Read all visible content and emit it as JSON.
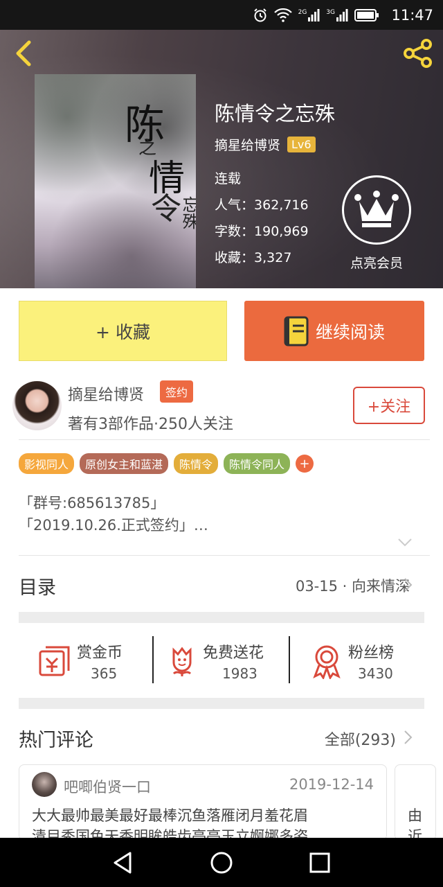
{
  "status_bar": {
    "time": "11:47",
    "network_1": "2G",
    "network_2": "3G"
  },
  "book": {
    "title": "陈情令之忘殊",
    "author": "摘星给博贤",
    "author_level": "Lv6",
    "status": "连载",
    "popularity_label": "人气：",
    "popularity": "362,716",
    "words_label": "字数：",
    "words": "190,969",
    "favorites_label": "收藏：",
    "favorites": "3,327"
  },
  "cover": {
    "title_char_1": "陈",
    "title_char_2": "之",
    "title_char_3": "情",
    "title_char_4": "令",
    "subtitle": "忘殊"
  },
  "vip": {
    "label": "点亮会员"
  },
  "actions": {
    "collect": "+ 收藏",
    "read": "继续阅读"
  },
  "author_card": {
    "name": "摘星给博贤",
    "badge": "签约",
    "stats": "著有3部作品·250人关注",
    "follow": "+关注"
  },
  "tags": [
    {
      "label": "影视同人",
      "color": "#f5a73c"
    },
    {
      "label": "原创女主和蓝湛",
      "color": "#b46a58"
    },
    {
      "label": "陈情令",
      "color": "#e3ad3a"
    },
    {
      "label": "陈情令同人",
      "color": "#8db357"
    }
  ],
  "tag_add": "+",
  "intro": {
    "line1": "「群号:685613785」",
    "line2": "「2019.10.26.正式签约」…"
  },
  "toc": {
    "label": "目录",
    "latest": "03-15 · 向来情深"
  },
  "stats": [
    {
      "label": "赏金币",
      "value": "365",
      "icon": "red-envelope-icon"
    },
    {
      "label": "免费送花",
      "value": "1983",
      "icon": "flower-icon"
    },
    {
      "label": "粉丝榜",
      "value": "3430",
      "icon": "medal-icon"
    }
  ],
  "comments": {
    "title": "热门评论",
    "all_label": "全部(293)",
    "items": [
      {
        "user": "吧唧伯贤一口",
        "date": "2019-12-14",
        "text_line1": "大大最帅最美最好最棒沉鱼落雁闭月羞花眉",
        "text_line2": "清目秀国色天香明眸皓齿亭亭玉立婀娜多姿"
      }
    ],
    "peek_text_1": "由",
    "peek_text_2": "近"
  },
  "colors": {
    "accent_orange": "#eb6a3e",
    "collect_yellow": "#fbf17c",
    "follow_red": "#d9493b",
    "lv_gold": "#e7b43b"
  }
}
